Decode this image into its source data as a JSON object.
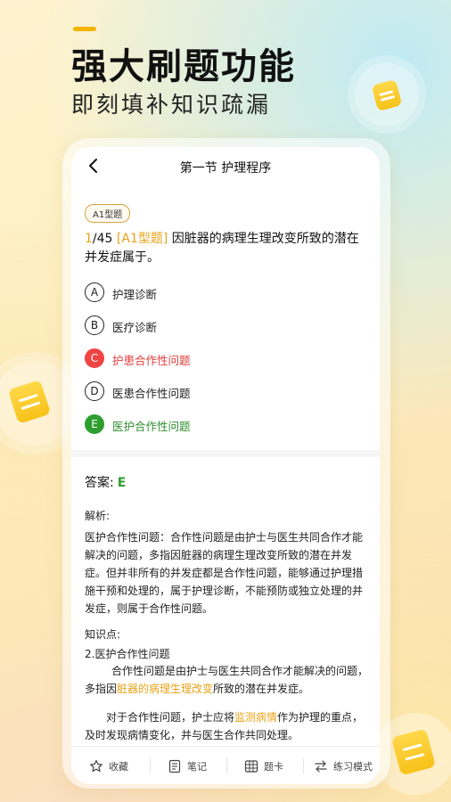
{
  "hero": {
    "title": "强大刷题功能",
    "subtitle": "即刻填补知识疏漏"
  },
  "header": {
    "title": "第一节 护理程序"
  },
  "question": {
    "type_badge": "A1型题",
    "current": "1",
    "total": "/45",
    "tag": "[A1型题]",
    "text": "因脏器的病理生理改变所致的潜在并发症属于。"
  },
  "options": [
    {
      "letter": "A",
      "text": "护理诊断",
      "state": "normal"
    },
    {
      "letter": "B",
      "text": "医疗诊断",
      "state": "normal"
    },
    {
      "letter": "C",
      "text": "护患合作性问题",
      "state": "wrong"
    },
    {
      "letter": "D",
      "text": "医患合作性问题",
      "state": "normal"
    },
    {
      "letter": "E",
      "text": "医护合作性问题",
      "state": "correct"
    }
  ],
  "answer": {
    "label": "答案:",
    "value": "E"
  },
  "explanation": {
    "label": "解析:",
    "text": "医护合作性问题：合作性问题是由护士与医生共同合作才能解决的问题，多指因脏器的病理生理改变所致的潜在并发症。但并非所有的并发症都是合作性问题，能够通过护理措施干预和处理的，属于护理诊断，不能预防或独立处理的并发症，则属于合作性问题。"
  },
  "knowledge": {
    "label": "知识点:",
    "title": "2.医护合作性问题",
    "p1_pre": "合作性问题是由护士与医生共同合作才能解决的问题，多指因",
    "p1_hl": "脏器的病理生理改变",
    "p1_post": "所致的潜在并发症。",
    "p2_pre": "对于合作性问题，护士应将",
    "p2_hl": "监测病情",
    "p2_post": "作为护理的重点，及时发现病情变化，并与医生合作共同处理。"
  },
  "bottom_bar": {
    "favorite": "收藏",
    "notes": "笔记",
    "answer_card": "题卡",
    "mode": "练习模式"
  },
  "colors": {
    "accent": "#e8a317",
    "wrong": "#ef4444",
    "correct": "#2e9e2e"
  }
}
